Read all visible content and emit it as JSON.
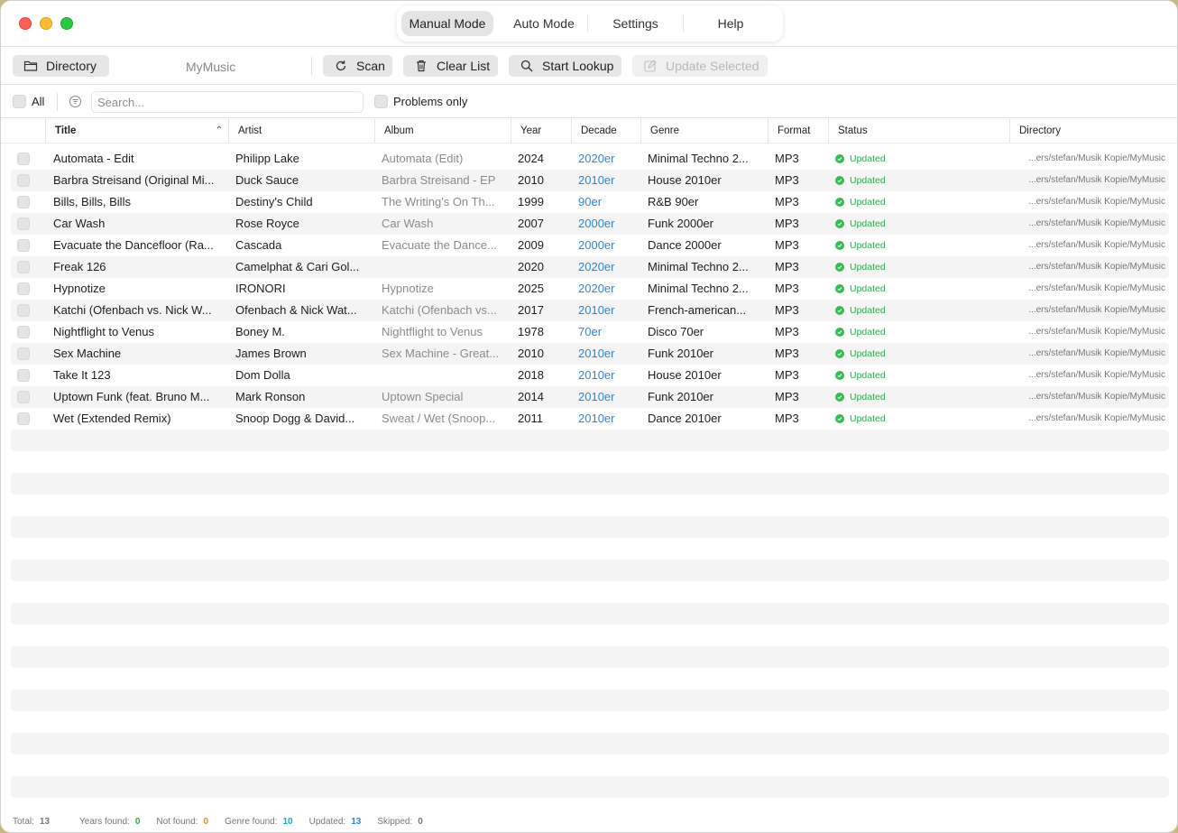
{
  "modes": {
    "manual": "Manual Mode",
    "auto": "Auto Mode",
    "settings": "Settings",
    "help": "Help"
  },
  "toolbar": {
    "directory_label": "Directory",
    "directory_name": "MyMusic",
    "scan_label": "Scan",
    "clear_label": "Clear List",
    "lookup_label": "Start Lookup",
    "update_label": "Update Selected"
  },
  "filter": {
    "all_label": "All",
    "search_placeholder": "Search...",
    "problems_label": "Problems only"
  },
  "columns": {
    "title": "Title",
    "artist": "Artist",
    "album": "Album",
    "year": "Year",
    "decade": "Decade",
    "genre": "Genre",
    "format": "Format",
    "status": "Status",
    "directory": "Directory"
  },
  "tracks": [
    {
      "title": "Automata - Edit",
      "artist": "Philipp Lake",
      "album": "Automata (Edit)",
      "year": "2024",
      "decade": "2020er",
      "genre": "Minimal Techno 2...",
      "format": "MP3",
      "status": "Updated",
      "dir": "...ers/stefan/Musik Kopie/MyMusic"
    },
    {
      "title": "Barbra Streisand (Original Mi...",
      "artist": "Duck Sauce",
      "album": "Barbra Streisand - EP",
      "year": "2010",
      "decade": "2010er",
      "genre": "House 2010er",
      "format": "MP3",
      "status": "Updated",
      "dir": "...ers/stefan/Musik Kopie/MyMusic"
    },
    {
      "title": "Bills, Bills, Bills",
      "artist": "Destiny's Child",
      "album": "The Writing's On Th...",
      "year": "1999",
      "decade": "90er",
      "genre": "R&B 90er",
      "format": "MP3",
      "status": "Updated",
      "dir": "...ers/stefan/Musik Kopie/MyMusic"
    },
    {
      "title": "Car Wash",
      "artist": "Rose Royce",
      "album": "Car Wash",
      "year": "2007",
      "decade": "2000er",
      "genre": "Funk 2000er",
      "format": "MP3",
      "status": "Updated",
      "dir": "...ers/stefan/Musik Kopie/MyMusic"
    },
    {
      "title": "Evacuate the Dancefloor (Ra...",
      "artist": "Cascada",
      "album": "Evacuate the Dance...",
      "year": "2009",
      "decade": "2000er",
      "genre": "Dance 2000er",
      "format": "MP3",
      "status": "Updated",
      "dir": "...ers/stefan/Musik Kopie/MyMusic"
    },
    {
      "title": "Freak 126",
      "artist": "Camelphat & Cari Gol...",
      "album": "",
      "year": "2020",
      "decade": "2020er",
      "genre": "Minimal Techno 2...",
      "format": "MP3",
      "status": "Updated",
      "dir": "...ers/stefan/Musik Kopie/MyMusic"
    },
    {
      "title": "Hypnotize",
      "artist": "IRONORI",
      "album": "Hypnotize",
      "year": "2025",
      "decade": "2020er",
      "genre": "Minimal Techno 2...",
      "format": "MP3",
      "status": "Updated",
      "dir": "...ers/stefan/Musik Kopie/MyMusic"
    },
    {
      "title": "Katchi (Ofenbach vs. Nick W...",
      "artist": "Ofenbach & Nick Wat...",
      "album": "Katchi (Ofenbach vs...",
      "year": "2017",
      "decade": "2010er",
      "genre": "French-american...",
      "format": "MP3",
      "status": "Updated",
      "dir": "...ers/stefan/Musik Kopie/MyMusic"
    },
    {
      "title": "Nightflight to Venus",
      "artist": "Boney M.",
      "album": "Nightflight to Venus",
      "year": "1978",
      "decade": "70er",
      "genre": "Disco 70er",
      "format": "MP3",
      "status": "Updated",
      "dir": "...ers/stefan/Musik Kopie/MyMusic"
    },
    {
      "title": "Sex Machine",
      "artist": "James Brown",
      "album": "Sex Machine - Great...",
      "year": "2010",
      "decade": "2010er",
      "genre": "Funk 2010er",
      "format": "MP3",
      "status": "Updated",
      "dir": "...ers/stefan/Musik Kopie/MyMusic"
    },
    {
      "title": "Take It 123",
      "artist": "Dom Dolla",
      "album": "",
      "year": "2018",
      "decade": "2010er",
      "genre": "House 2010er",
      "format": "MP3",
      "status": "Updated",
      "dir": "...ers/stefan/Musik Kopie/MyMusic"
    },
    {
      "title": "Uptown Funk (feat. Bruno M...",
      "artist": "Mark Ronson",
      "album": "Uptown Special",
      "year": "2014",
      "decade": "2010er",
      "genre": "Funk 2010er",
      "format": "MP3",
      "status": "Updated",
      "dir": "...ers/stefan/Musik Kopie/MyMusic"
    },
    {
      "title": "Wet (Extended Remix)",
      "artist": "Snoop Dogg & David...",
      "album": "Sweat / Wet (Snoop...",
      "year": "2011",
      "decade": "2010er",
      "genre": "Dance 2010er",
      "format": "MP3",
      "status": "Updated",
      "dir": "...ers/stefan/Musik Kopie/MyMusic"
    }
  ],
  "stats": {
    "total_label": "Total:",
    "total": "13",
    "years_label": "Years found:",
    "years": "0",
    "notfound_label": "Not found:",
    "notfound": "0",
    "genre_label": "Genre found:",
    "genre": "10",
    "updated_label": "Updated:",
    "updated": "13",
    "skipped_label": "Skipped:",
    "skipped": "0"
  },
  "colors": {
    "decade_link": "#2a86d9",
    "status_green": "#2ea84f",
    "stat_years": "#2ea84f",
    "stat_notfound": "#e08a1e",
    "stat_genre": "#2aa0c8",
    "stat_updated": "#2a86d9"
  }
}
